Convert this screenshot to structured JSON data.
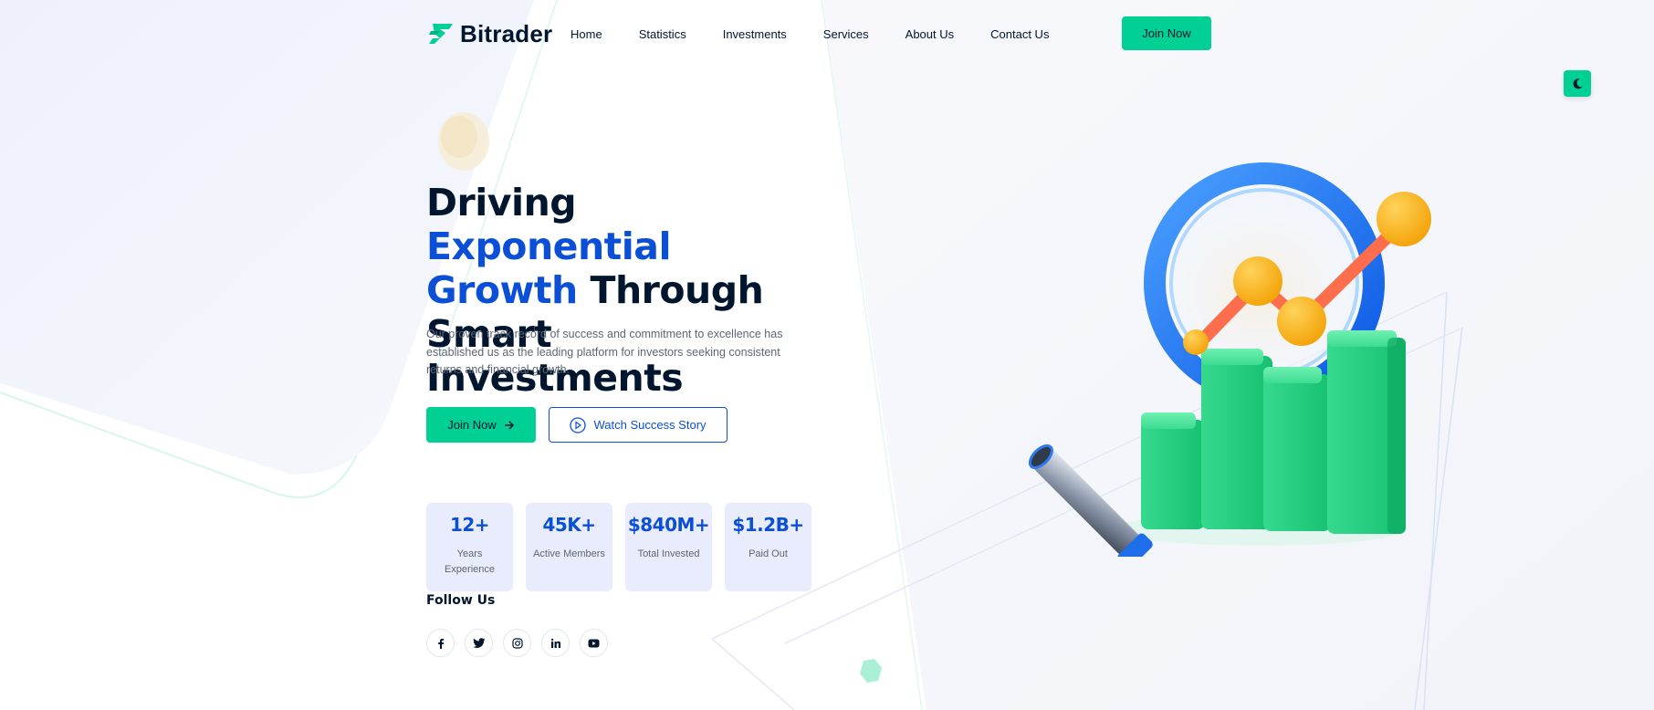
{
  "brand": {
    "name": "Bitrader",
    "primary": "#00d094",
    "accent": "#0a4fd5",
    "text": "#00152e"
  },
  "nav": {
    "items": [
      "Home",
      "Statistics",
      "Investments",
      "Services",
      "About Us",
      "Contact Us"
    ],
    "cta_label": "Join Now"
  },
  "theme_toggle": {
    "icon": "moon-icon"
  },
  "hero": {
    "title_part1": "Driving ",
    "title_accent": "Exponential Growth",
    "title_part2": " Through Smart Investments",
    "description": "Our proven track record of success and commitment to excellence has established us as the leading platform for investors seeking consistent returns and financial growth.",
    "primary_button": "Join Now",
    "secondary_button": "Watch Success Story"
  },
  "stats": [
    {
      "value": "12+",
      "label": "Years Experience"
    },
    {
      "value": "45K+",
      "label": "Active Members"
    },
    {
      "value": "$840M+",
      "label": "Total Invested"
    },
    {
      "value": "$1.2B+",
      "label": "Paid Out"
    }
  ],
  "follow": {
    "title": "Follow Us",
    "icons": [
      "facebook-icon",
      "twitter-icon",
      "instagram-icon",
      "linkedin-icon",
      "youtube-icon"
    ]
  }
}
